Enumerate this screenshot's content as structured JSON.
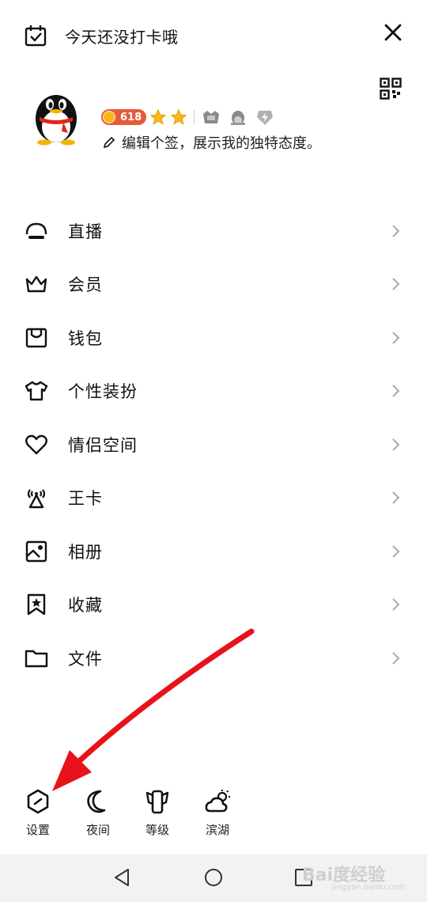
{
  "checkin": {
    "text": "今天还没打卡哦"
  },
  "profile": {
    "vip_level": "618",
    "signature": "编辑个签，展示我的独特态度。"
  },
  "menu": [
    {
      "label": "直播",
      "icon": "live-icon"
    },
    {
      "label": "会员",
      "icon": "crown-icon"
    },
    {
      "label": "钱包",
      "icon": "wallet-icon"
    },
    {
      "label": "个性装扮",
      "icon": "tshirt-icon"
    },
    {
      "label": "情侣空间",
      "icon": "heart-icon"
    },
    {
      "label": "王卡",
      "icon": "antenna-icon"
    },
    {
      "label": "相册",
      "icon": "photo-album-icon"
    },
    {
      "label": "收藏",
      "icon": "bookmark-star-icon"
    },
    {
      "label": "文件",
      "icon": "folder-icon"
    }
  ],
  "bottom": [
    {
      "label": "设置",
      "icon": "settings-hexagon-icon"
    },
    {
      "label": "夜间",
      "icon": "moon-icon"
    },
    {
      "label": "等级",
      "icon": "level-icon"
    },
    {
      "label": "滨湖",
      "icon": "weather-cloud-sun-icon"
    }
  ],
  "watermark": {
    "main": "Bai度经验",
    "sub": "jingyan.baidu.com"
  },
  "colors": {
    "accent_red": "#e8121b",
    "badge": "#e55a3c",
    "star": "#f8b818"
  }
}
